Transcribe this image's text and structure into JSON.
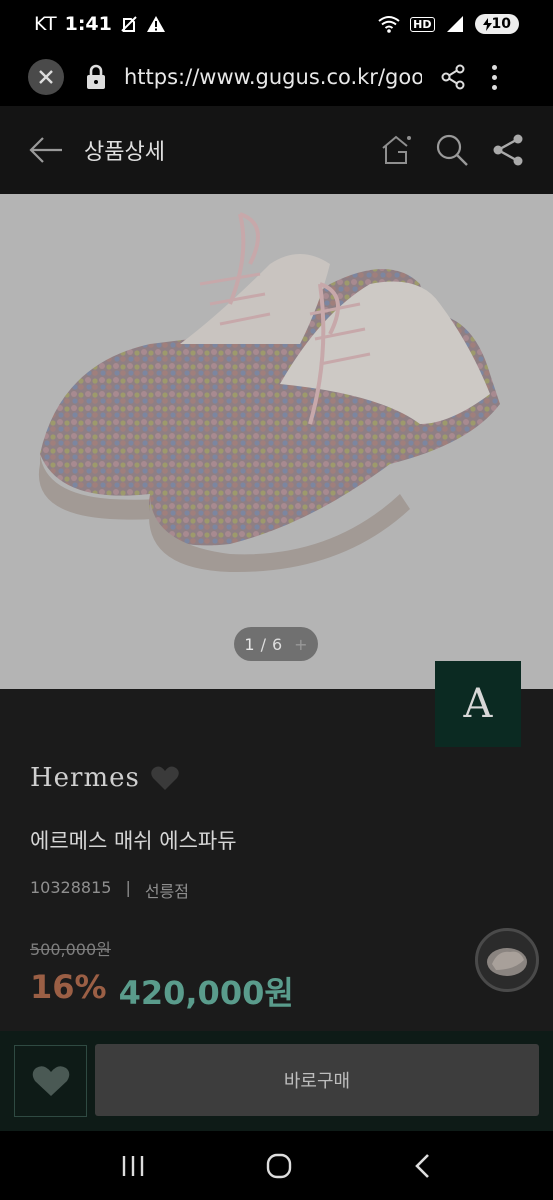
{
  "status": {
    "carrier": "KT",
    "time": "1:41",
    "battery": "10",
    "hd": "HD"
  },
  "browser": {
    "url": "https://www.gugus.co.kr/goo"
  },
  "header": {
    "title": "상품상세"
  },
  "gallery": {
    "current": "1",
    "separator": "/",
    "total": "6",
    "plus": "+"
  },
  "badge": {
    "letter": "A"
  },
  "product": {
    "brand": "Hermes",
    "name": "에르메스 매쉬 에스파듀",
    "code": "10328815",
    "divider": "|",
    "store": "선릉점",
    "original_price": "500,000원",
    "discount": "16%",
    "price": "420,000원"
  },
  "actions": {
    "buy_label": "바로구매"
  },
  "colors": {
    "accent_green": "#0b2a22",
    "price_teal": "#5a9c8c",
    "discount_brown": "#9b5f45"
  }
}
